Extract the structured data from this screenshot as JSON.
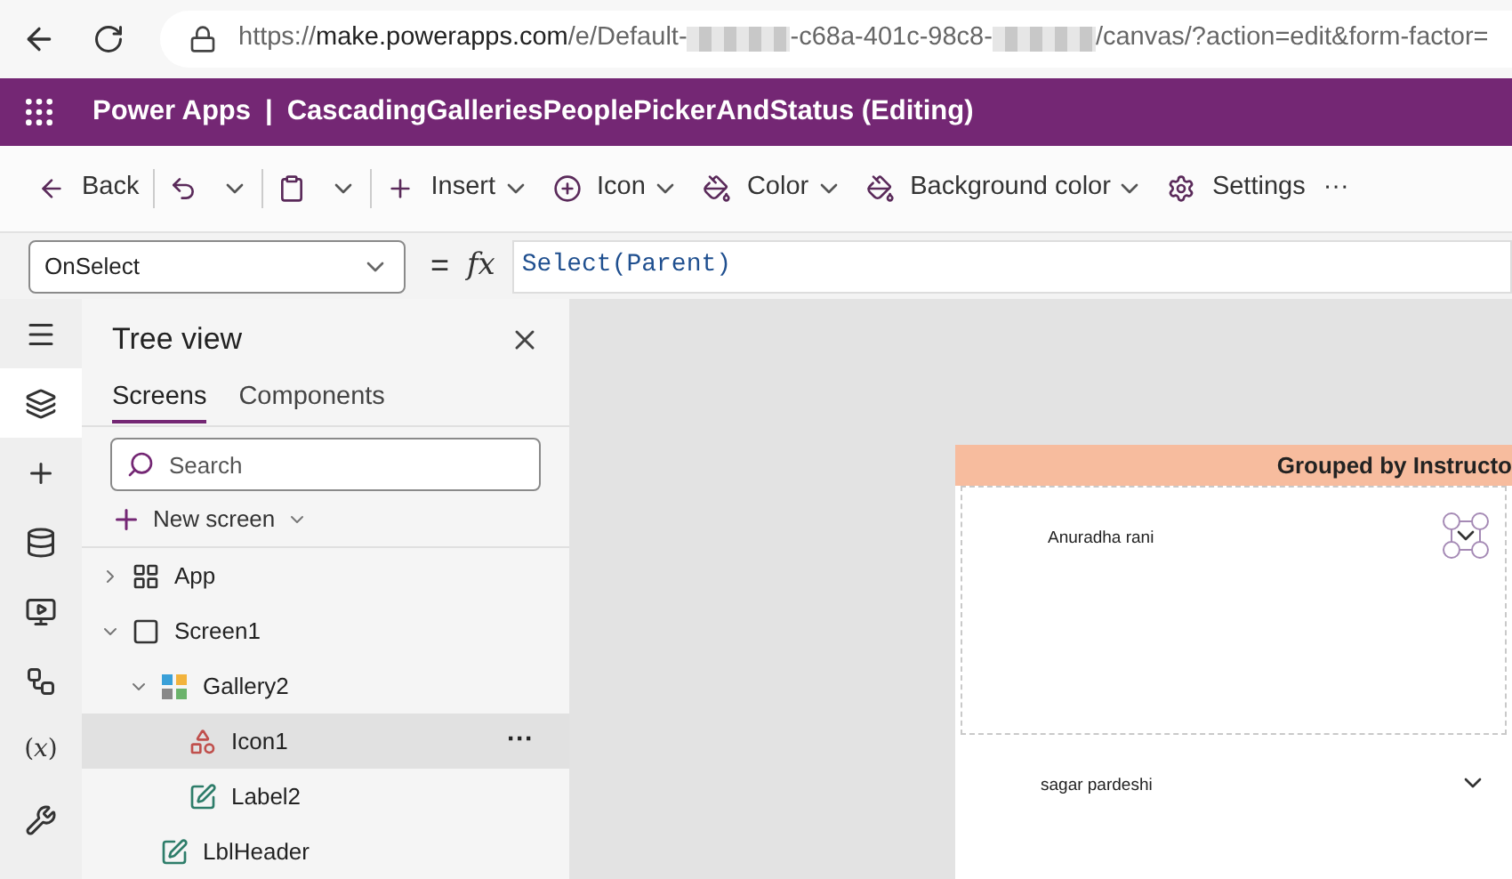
{
  "browser": {
    "url_parts": [
      {
        "kind": "text",
        "text": "https://"
      },
      {
        "kind": "strong",
        "text": "make.powerapps.com"
      },
      {
        "kind": "text",
        "text": "/e/Default-"
      },
      {
        "kind": "redacted"
      },
      {
        "kind": "text",
        "text": "-c68a-401c-98c8-"
      },
      {
        "kind": "redacted"
      },
      {
        "kind": "text",
        "text": "/canvas/?action=edit&form-factor="
      }
    ]
  },
  "header": {
    "app": "Power Apps",
    "separator": "|",
    "title": "CascadingGalleriesPeoplePickerAndStatus (Editing)"
  },
  "toolbar": [
    {
      "kind": "back",
      "label": "Back"
    },
    {
      "kind": "undo"
    },
    {
      "kind": "paste"
    },
    {
      "kind": "insert",
      "label": "Insert"
    },
    {
      "kind": "icon",
      "label": "Icon"
    },
    {
      "kind": "color",
      "label": "Color"
    },
    {
      "kind": "background",
      "label": "Background color"
    },
    {
      "kind": "settings",
      "label": "Settings"
    },
    {
      "kind": "more",
      "label": "···"
    }
  ],
  "formula_bar": {
    "property": "OnSelect",
    "equals": "=",
    "fx": "fx",
    "formula": "Select(Parent)"
  },
  "rail": [
    {
      "kind": "menu",
      "selected": false
    },
    {
      "kind": "layers",
      "selected": true
    },
    {
      "kind": "plus",
      "selected": false
    },
    {
      "kind": "database",
      "selected": false
    },
    {
      "kind": "media",
      "selected": false
    },
    {
      "kind": "automate",
      "selected": false
    },
    {
      "kind": "variables",
      "glyph": "(𝑥)",
      "selected": false
    },
    {
      "kind": "tools",
      "selected": false
    }
  ],
  "tree_view": {
    "title": "Tree view",
    "tabs": [
      {
        "label": "Screens",
        "selected": true
      },
      {
        "label": "Components",
        "selected": false
      }
    ],
    "search": {
      "placeholder": "Search"
    },
    "new_screen": "New screen",
    "items": [
      {
        "kind": "app",
        "label": "App",
        "expanded": false,
        "selected": false
      },
      {
        "kind": "screen",
        "label": "Screen1",
        "expanded": true,
        "selected": false,
        "children": [
          {
            "kind": "gallery",
            "label": "Gallery2",
            "expanded": true,
            "selected": false,
            "children": [
              {
                "kind": "icon",
                "label": "Icon1",
                "selected": true,
                "more": "···"
              },
              {
                "kind": "label",
                "label": "Label2",
                "selected": false
              }
            ]
          },
          {
            "kind": "label",
            "label": "LblHeader",
            "selected": false
          }
        ]
      }
    ]
  },
  "canvas": {
    "header": "Grouped by Instructo",
    "rows": [
      {
        "name": "Anuradha rani",
        "selected": true
      },
      {
        "name": "sagar pardeshi",
        "selected": false
      }
    ]
  }
}
